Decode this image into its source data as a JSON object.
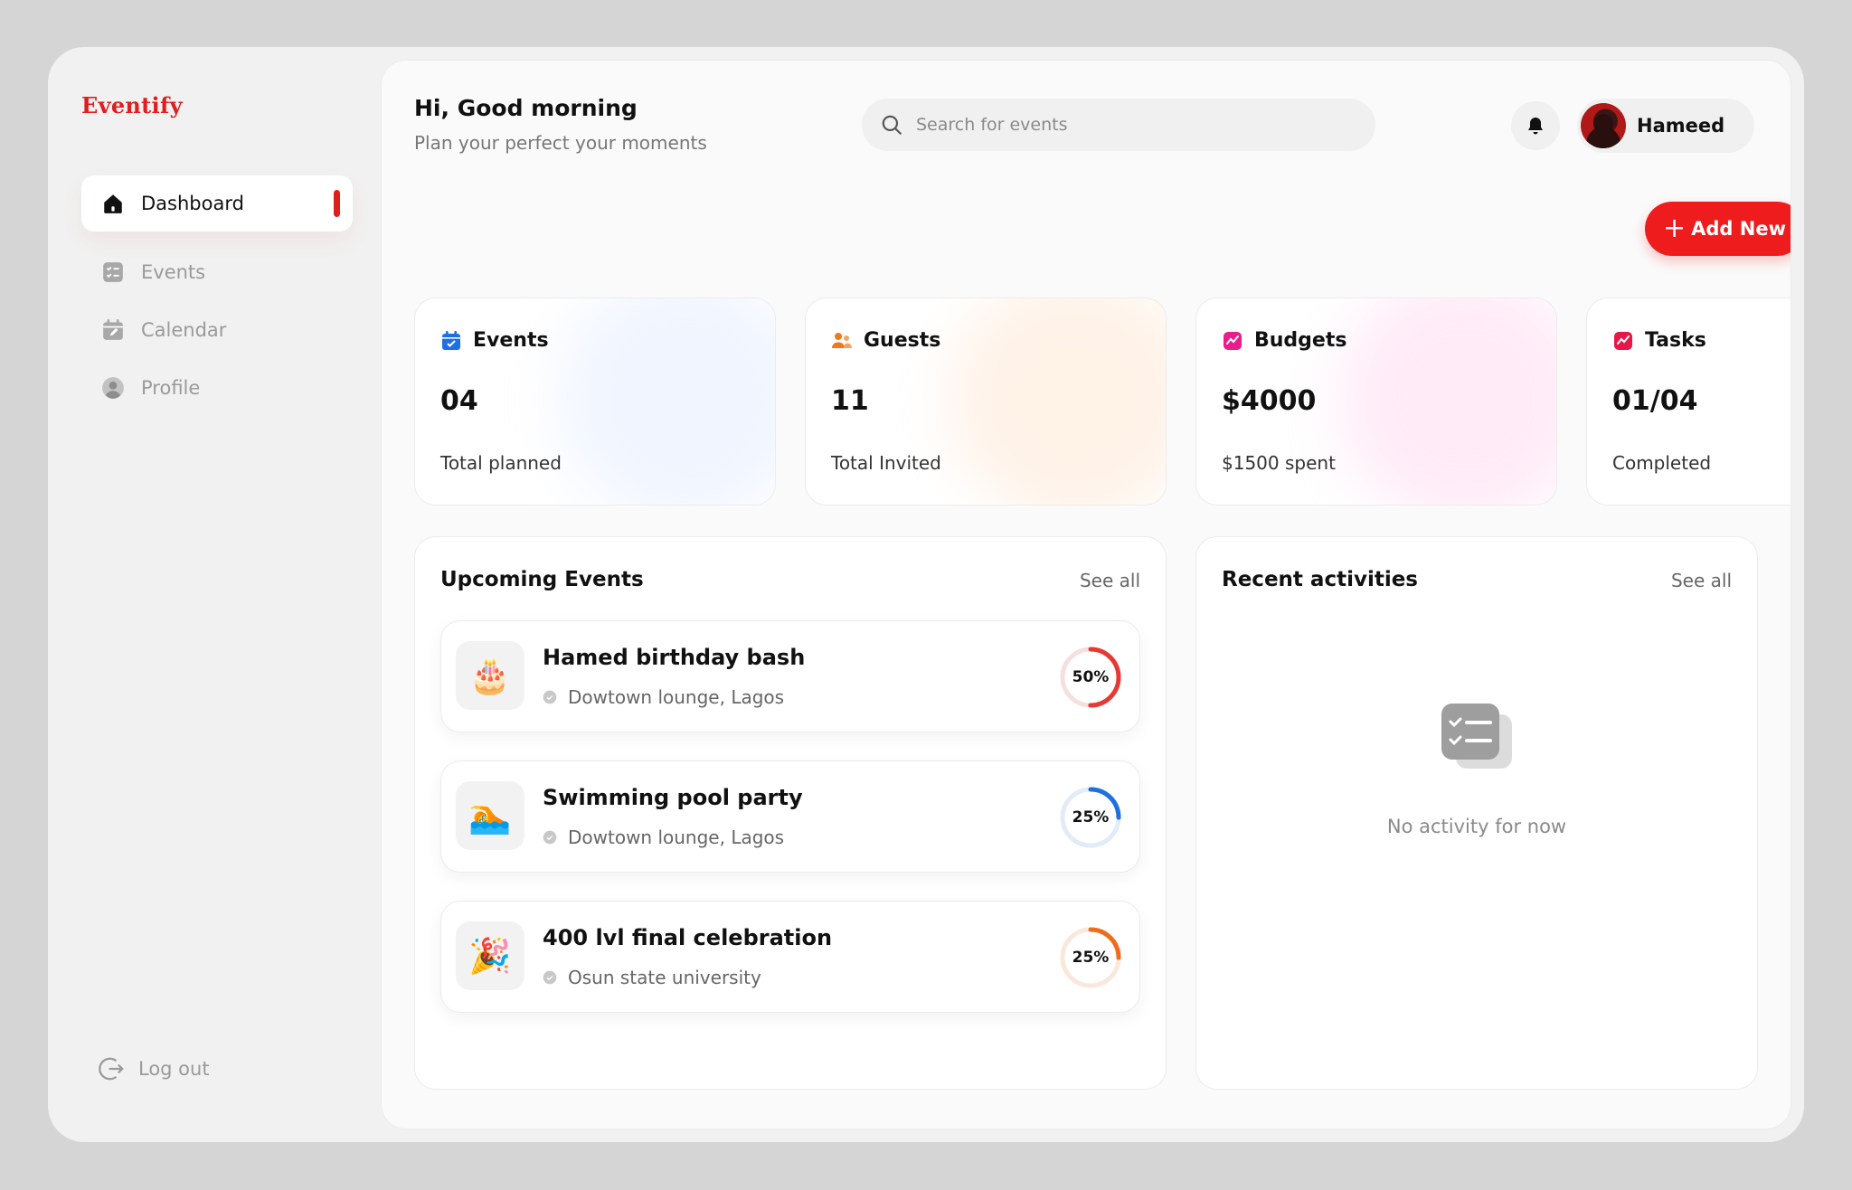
{
  "brand": "Eventify",
  "sidebar": {
    "items": [
      {
        "label": "Dashboard",
        "icon": "home-icon",
        "active": true
      },
      {
        "label": "Events",
        "icon": "checklist-icon"
      },
      {
        "label": "Calendar",
        "icon": "calendar-edit-icon"
      },
      {
        "label": "Profile",
        "icon": "user-circle-icon"
      }
    ],
    "logout": "Log out"
  },
  "header": {
    "greeting": "Hi, Good morning",
    "subtitle": "Plan your perfect your moments",
    "search_placeholder": "Search for events",
    "user_name": "Hameed",
    "add_button": "Add New"
  },
  "stats": [
    {
      "label": "Events",
      "value": "04",
      "caption": "Total planned",
      "icon": "calendar-check-icon",
      "color": "#1f6fe6"
    },
    {
      "label": "Guests",
      "value": "11",
      "caption": "Total Invited",
      "icon": "users-icon",
      "color": "#f0781e"
    },
    {
      "label": "Budgets",
      "value": "$4000",
      "caption": "$1500 spent",
      "icon": "chart-icon",
      "color": "#e91e8c"
    },
    {
      "label": "Tasks",
      "value": "01/04",
      "caption": "Completed",
      "icon": "chart-icon",
      "color": "#e8174a"
    }
  ],
  "upcoming": {
    "title": "Upcoming Events",
    "see_all": "See all",
    "events": [
      {
        "title": "Hamed birthday bash",
        "location": "Dowtown lounge, Lagos",
        "progress": 50,
        "progress_label": "50%",
        "color": "#e53935",
        "emoji": "🎂"
      },
      {
        "title": "Swimming pool party",
        "location": "Dowtown lounge, Lagos",
        "progress": 25,
        "progress_label": "25%",
        "color": "#1e6fe0",
        "emoji": "🏊"
      },
      {
        "title": "400 lvl final celebration",
        "location": "Osun state university",
        "progress": 25,
        "progress_label": "25%",
        "color": "#ef6c1a",
        "emoji": "🎉"
      }
    ]
  },
  "activities": {
    "title": "Recent activities",
    "see_all": "See all",
    "empty_text": "No activity for now"
  },
  "colors": {
    "accent": "#ee1c1c",
    "brand": "#e11d1d"
  }
}
